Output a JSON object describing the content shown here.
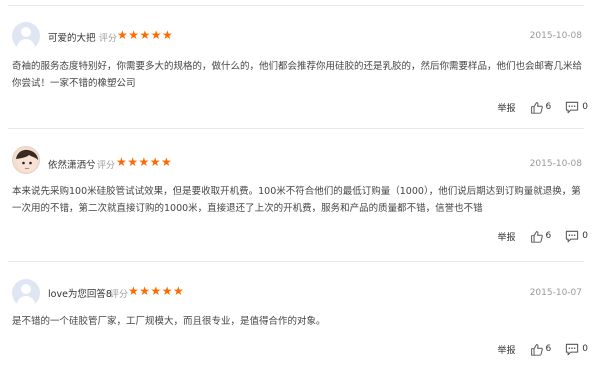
{
  "rating_label": "评分",
  "stars": "★★★★★",
  "report_label": "举报",
  "icons": {
    "like": "thumbs-up-icon",
    "comment": "comment-bubble-icon",
    "avatar_default": "default-avatar-icon"
  },
  "accent_color": "#ff6a00",
  "reviews": [
    {
      "username": "可爱的大把",
      "date": "2015-10-08",
      "content": "奇袖的服务态度特别好，你需要多大的规格的，做什么的，他们都会推荐你用硅胶的还是乳胶的，然后你需要样品，他们也会邮寄几米给你尝试！一家不错的橡塑公司",
      "likes": "6",
      "comments": "0"
    },
    {
      "username": "依然潇洒兮",
      "date": "2015-10-08",
      "content": "本来说先采购100米硅胶管试试效果，但是要收取开机费。100米不符合他们的最低订购量（1000），他们说后期达到订购量就退换，第一次用的不错，第二次就直接订购的1000米，直接退还了上次的开机费，服务和产品的质量都不错，信誉也不错",
      "likes": "6",
      "comments": "0"
    },
    {
      "username": "love为您回答8",
      "date": "2015-10-07",
      "content": "是不错的一个硅胶管厂家，工厂规模大，而且很专业，是值得合作的对象。",
      "likes": "6",
      "comments": "0"
    }
  ]
}
